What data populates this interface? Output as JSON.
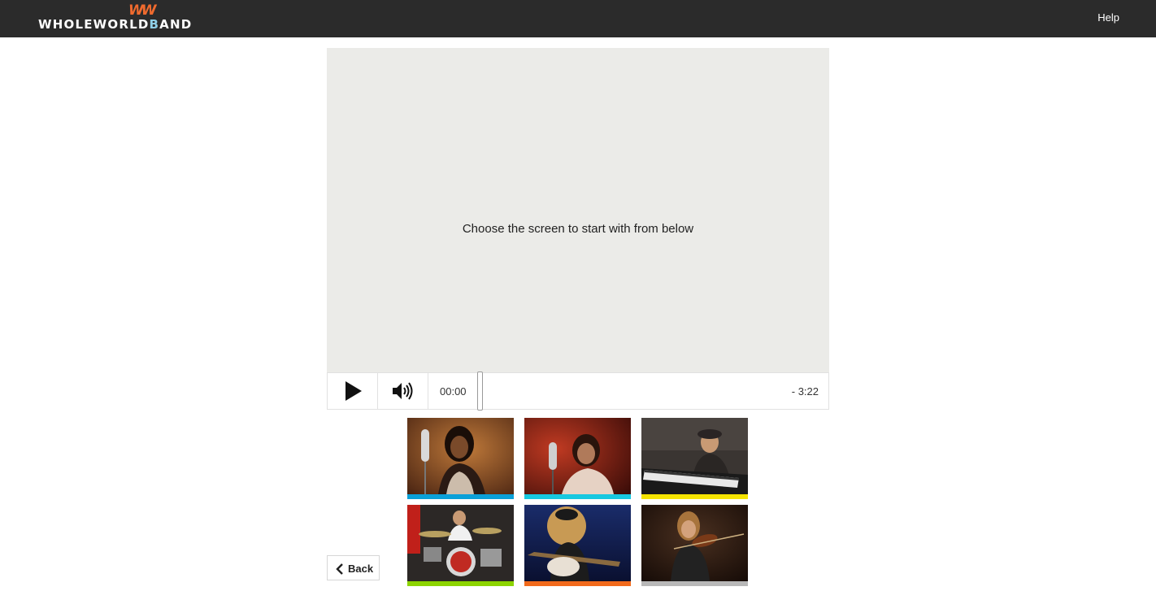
{
  "header": {
    "logo_prefix": "WHOLEWORLD",
    "logo_b": "B",
    "logo_suffix": "AND",
    "logo_mark": "WW",
    "help_label": "Help"
  },
  "player": {
    "message": "Choose the screen to start with from below",
    "current_time": "00:00",
    "remaining_time": "- 3:22",
    "progress_fraction": 0
  },
  "thumbnails": [
    {
      "subject": "singer-with-headphones",
      "color": "#0aa0d8"
    },
    {
      "subject": "male-singer",
      "color": "#17c8e0"
    },
    {
      "subject": "keyboard-player",
      "color": "#f5e400"
    },
    {
      "subject": "drummer",
      "color": "#8cd400"
    },
    {
      "subject": "bass-guitarist",
      "color": "#f26a1b"
    },
    {
      "subject": "violinist",
      "color": "#b8b8b8"
    }
  ],
  "footer": {
    "back_label": "Back"
  },
  "icons": {
    "play": "play-icon",
    "volume": "volume-icon",
    "back": "chevron-left-icon"
  }
}
